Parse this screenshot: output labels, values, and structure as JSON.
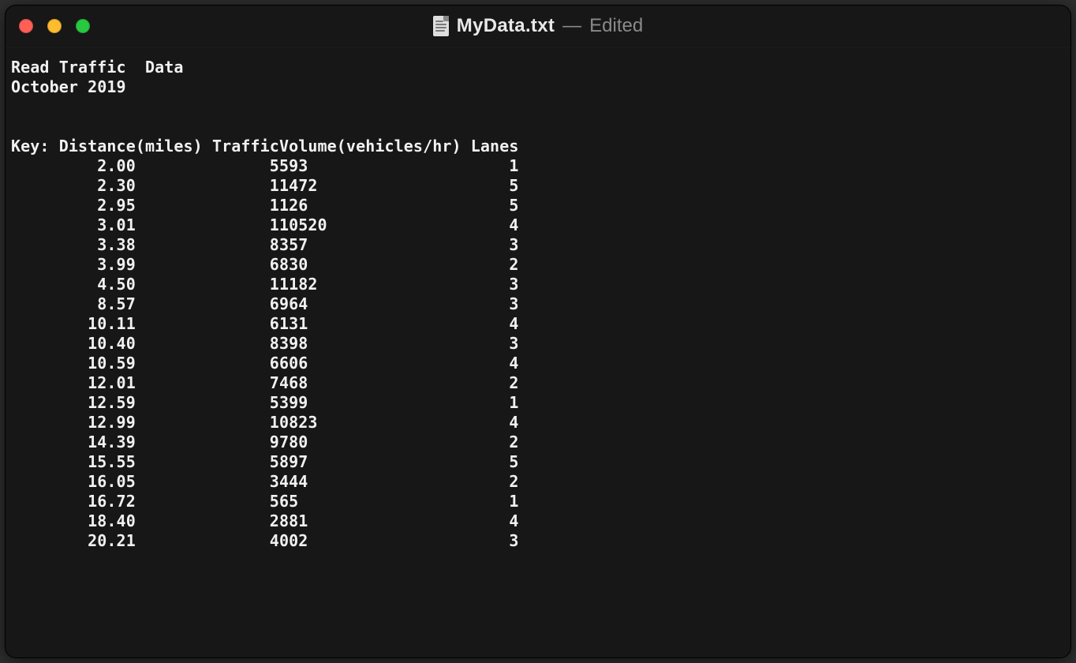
{
  "window": {
    "icon": "document-icon",
    "file_name": "MyData.txt",
    "separator": "—",
    "state": "Edited"
  },
  "document": {
    "heading1": "Read Traffic  Data",
    "heading2": "October 2019",
    "blank": "",
    "key_line": "Key: Distance(miles) TrafficVolume(vehicles/hr) Lanes",
    "columns": [
      "Distance(miles)",
      "TrafficVolume(vehicles/hr)",
      "Lanes"
    ],
    "rows": [
      {
        "distance": "2.00",
        "volume": "5593",
        "lanes": "1"
      },
      {
        "distance": "2.30",
        "volume": "11472",
        "lanes": "5"
      },
      {
        "distance": "2.95",
        "volume": "1126",
        "lanes": "5"
      },
      {
        "distance": "3.01",
        "volume": "110520",
        "lanes": "4"
      },
      {
        "distance": "3.38",
        "volume": "8357",
        "lanes": "3"
      },
      {
        "distance": "3.99",
        "volume": "6830",
        "lanes": "2"
      },
      {
        "distance": "4.50",
        "volume": "11182",
        "lanes": "3"
      },
      {
        "distance": "8.57",
        "volume": "6964",
        "lanes": "3"
      },
      {
        "distance": "10.11",
        "volume": "6131",
        "lanes": "4"
      },
      {
        "distance": "10.40",
        "volume": "8398",
        "lanes": "3"
      },
      {
        "distance": "10.59",
        "volume": "6606",
        "lanes": "4"
      },
      {
        "distance": "12.01",
        "volume": "7468",
        "lanes": "2"
      },
      {
        "distance": "12.59",
        "volume": "5399",
        "lanes": "1"
      },
      {
        "distance": "12.99",
        "volume": "10823",
        "lanes": "4"
      },
      {
        "distance": "14.39",
        "volume": "9780",
        "lanes": "2"
      },
      {
        "distance": "15.55",
        "volume": "5897",
        "lanes": "5"
      },
      {
        "distance": "16.05",
        "volume": "3444",
        "lanes": "2"
      },
      {
        "distance": "16.72",
        "volume": "565",
        "lanes": "1"
      },
      {
        "distance": "18.40",
        "volume": "2881",
        "lanes": "4"
      },
      {
        "distance": "20.21",
        "volume": "4002",
        "lanes": "3"
      }
    ]
  }
}
